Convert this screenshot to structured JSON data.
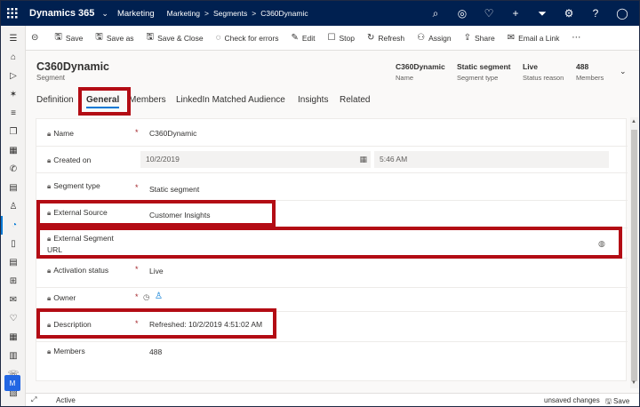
{
  "topbar": {
    "app_name": "Dynamics 365",
    "area": "Marketing",
    "breadcrumb": [
      "Marketing",
      ">",
      "Segments",
      ">",
      "C360Dynamic"
    ]
  },
  "commands": [
    {
      "label": "Save",
      "icon": "save-icon",
      "glyph": "🖫"
    },
    {
      "label": "Save as",
      "icon": "save-as-icon",
      "glyph": "🖫"
    },
    {
      "label": "Save & Close",
      "icon": "save-close-icon",
      "glyph": "🖫"
    },
    {
      "label": "Check for errors",
      "icon": "check-icon",
      "glyph": "◌"
    },
    {
      "label": "Edit",
      "icon": "edit-icon",
      "glyph": "✎"
    },
    {
      "label": "Stop",
      "icon": "stop-icon",
      "glyph": "☐"
    },
    {
      "label": "Refresh",
      "icon": "refresh-icon",
      "glyph": "↻"
    },
    {
      "label": "Assign",
      "icon": "assign-icon",
      "glyph": "⚇"
    },
    {
      "label": "Share",
      "icon": "share-icon",
      "glyph": "⇪"
    },
    {
      "label": "Email a Link",
      "icon": "email-icon",
      "glyph": "✉"
    }
  ],
  "record": {
    "title": "C360Dynamic",
    "type": "Segment",
    "header_fields": [
      {
        "value": "C360Dynamic",
        "label": "Name"
      },
      {
        "value": "Static segment",
        "label": "Segment type"
      },
      {
        "value": "Live",
        "label": "Status reason"
      },
      {
        "value": "488",
        "label": "Members"
      }
    ]
  },
  "tabs": [
    "Definition",
    "General",
    "Members",
    "LinkedIn Matched Audience",
    "Insights",
    "Related"
  ],
  "active_tab": "General",
  "fields": {
    "name": {
      "label": "Name",
      "value": "C360Dynamic"
    },
    "created_on": {
      "label": "Created on",
      "date": "10/2/2019",
      "time": "5:46 AM"
    },
    "segment_type": {
      "label": "Segment type",
      "value": "Static segment"
    },
    "external_source": {
      "label": "External Source",
      "value": "Customer Insights"
    },
    "external_segment_url": {
      "label_line1": "External Segment",
      "label_line2": "URL",
      "value": ""
    },
    "activation_status": {
      "label": "Activation status",
      "value": "Live"
    },
    "owner": {
      "label": "Owner"
    },
    "description": {
      "label": "Description",
      "value": "Refreshed: 10/2/2019 4:51:02 AM"
    },
    "members": {
      "label": "Members",
      "value": "488"
    }
  },
  "status_bar": {
    "state": "Active",
    "unsaved": "unsaved changes",
    "save": "Save"
  },
  "avatar_initial": "M",
  "colors": {
    "topbar": "#002050",
    "accent": "#0078d4",
    "highlight": "#b30c14",
    "required": "#a4262c"
  }
}
